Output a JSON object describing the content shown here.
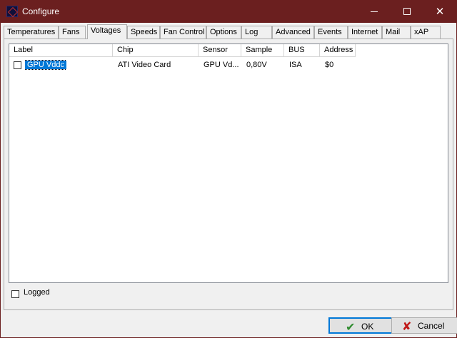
{
  "window": {
    "title": "Configure",
    "minimize_icon": "minimize-icon",
    "maximize_icon": "maximize-icon",
    "close_glyph": "✕"
  },
  "tabs": [
    {
      "label": "Temperatures"
    },
    {
      "label": "Fans"
    },
    {
      "label": "Voltages",
      "active": true
    },
    {
      "label": "Speeds"
    },
    {
      "label": "Fan Control"
    },
    {
      "label": "Options"
    },
    {
      "label": "Log"
    },
    {
      "label": "Advanced"
    },
    {
      "label": "Events"
    },
    {
      "label": "Internet"
    },
    {
      "label": "Mail"
    },
    {
      "label": "xAP"
    }
  ],
  "list": {
    "columns": [
      "Label",
      "Chip",
      "Sensor",
      "Sample",
      "BUS",
      "Address"
    ],
    "rows": [
      {
        "checked": false,
        "label": "GPU Vddc",
        "chip": "ATI Video Card",
        "sensor": "GPU Vd...",
        "sample": "0,80V",
        "bus": "ISA",
        "address": "$0"
      }
    ]
  },
  "logged": {
    "label": "Logged",
    "checked": false
  },
  "buttons": {
    "ok": {
      "label": "OK",
      "glyph": "✔",
      "color": "#2e8b2e"
    },
    "cancel": {
      "label": "Cancel",
      "glyph": "✘",
      "color": "#c01818"
    }
  },
  "colors": {
    "titlebar": "#6b1f1f",
    "selection": "#0078d7"
  }
}
